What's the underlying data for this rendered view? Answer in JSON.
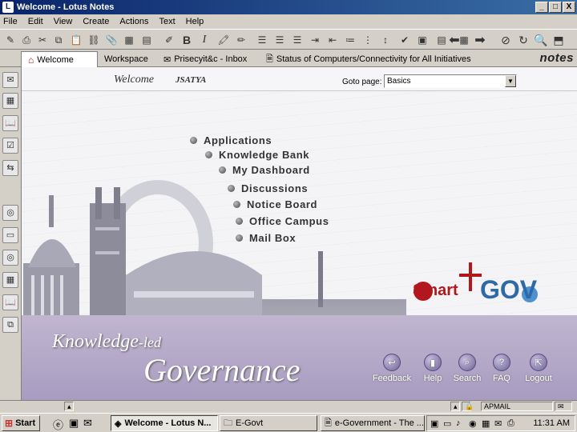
{
  "window": {
    "title": "Welcome - Lotus Notes",
    "controls": [
      "_",
      "□",
      "X"
    ]
  },
  "menu": [
    "File",
    "Edit",
    "View",
    "Create",
    "Actions",
    "Text",
    "Help"
  ],
  "toolbar": {
    "bold_label": "B",
    "italic_label": "I"
  },
  "tabs": [
    {
      "label": "Welcome",
      "icon": "home-icon"
    },
    {
      "label": "Workspace",
      "icon": ""
    },
    {
      "label": "Prisecyit&c - Inbox",
      "icon": "inbox-icon"
    },
    {
      "label": "Status of Computers/Connectivity for All Initiatives",
      "icon": "document-icon"
    }
  ],
  "brand_logo": "notes",
  "page": {
    "welcome_title": "Welcome",
    "username": "JSATYA",
    "goto_label": "Goto page:",
    "goto_value": "Basics"
  },
  "links": [
    "Applications",
    "Knowledge Bank",
    "My Dashboard",
    "Discussions",
    "Notice Board",
    "Office Campus",
    "Mail Box"
  ],
  "branding": {
    "smart": "Smart",
    "gov": "GOV",
    "tagline_1": "Knowledge",
    "tagline_1_suffix": "-led",
    "tagline_2": "Governance"
  },
  "bottom_actions": [
    {
      "label": "Feedback",
      "icon": "back-arrow-icon"
    },
    {
      "label": "Help",
      "icon": "book-icon"
    },
    {
      "label": "Search",
      "icon": "search-icon"
    },
    {
      "label": "FAQ",
      "icon": "question-icon"
    },
    {
      "label": "Logout",
      "icon": "logout-icon"
    }
  ],
  "status_bar": {
    "mail_location": "APMAIL"
  },
  "taskbar": {
    "start_label": "Start",
    "tasks": [
      "Welcome - Lotus N...",
      "E-Govt",
      "e-Government - The ..."
    ],
    "clock": "11:31 AM"
  },
  "colors": {
    "title_bar": "#0a246a",
    "smart_red": "#b3171e",
    "gov_blue": "#2e6aa8",
    "band_purple": "#a89cc0"
  }
}
